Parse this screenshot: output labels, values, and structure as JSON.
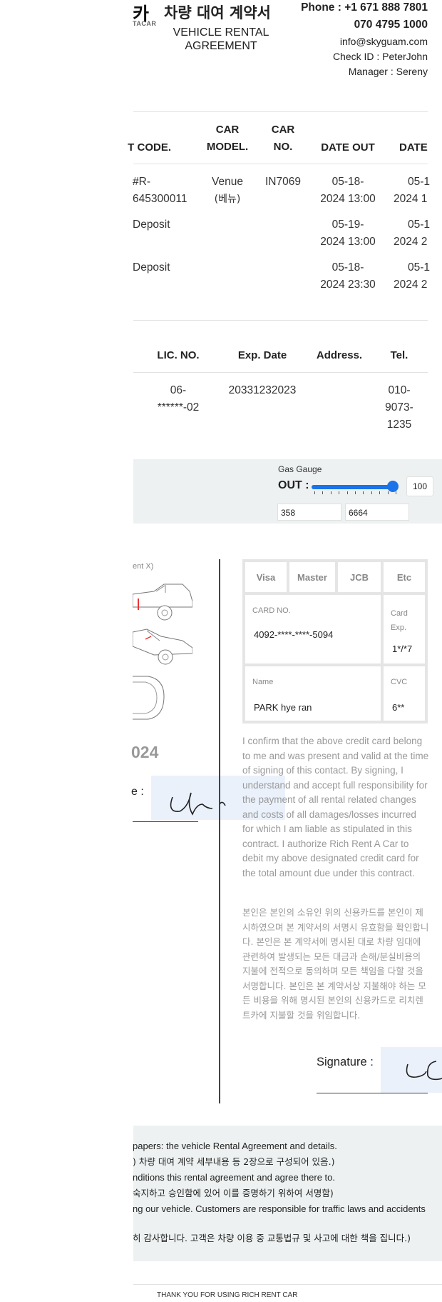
{
  "header": {
    "logo_text": "카",
    "logo_sub": "TACAR",
    "title_kr": "차량 대여 계약서",
    "title_en": "VEHICLE RENTAL AGREEMENT",
    "phone": "Phone : +1 671 888 7801",
    "phone2": "070 4795 1000",
    "email": "info@skyguam.com",
    "checkin": "Check ID : PeterJohn",
    "manager": "Manager : Sereny"
  },
  "rental_table": {
    "headers": [
      "T CODE.",
      "CAR",
      "MODEL.",
      "CAR",
      "NO.",
      "DATE OUT",
      "DATE"
    ],
    "rows": [
      {
        "code_1": "#R-",
        "code_2": "645300011",
        "model_1": "Venue",
        "model_2": "(베뉴)",
        "carno": "IN7069",
        "out_1": "05-18-",
        "out_2": "2024 13:00",
        "in_1": "05-1",
        "in_2": "2024 1"
      },
      {
        "code_1": "Deposit",
        "out_1": "05-19-",
        "out_2": "2024 13:00",
        "in_1": "05-1",
        "in_2": "2024 2"
      },
      {
        "code_1": "Deposit",
        "out_1": "05-18-",
        "out_2": "2024 23:30",
        "in_1": "05-1",
        "in_2": "2024 2"
      }
    ]
  },
  "license_table": {
    "headers": [
      "LIC. NO.",
      "Exp. Date",
      "Address.",
      "Tel."
    ],
    "row": {
      "lic_1": "06-",
      "lic_2": "******-02",
      "exp": "20331232023",
      "address": "",
      "tel_1": "010-",
      "tel_2": "9073-",
      "tel_3": "1235"
    }
  },
  "gauge": {
    "label": "Gas Gauge",
    "out_label": "OUT :",
    "value": 100,
    "value_text": "100",
    "mileage_1": "358",
    "mileage_2": "6664"
  },
  "left_section": {
    "caption": "ent X)",
    "date_fragment": "024",
    "sig_label": "e :"
  },
  "card": {
    "types": [
      "Visa",
      "Master",
      "JCB",
      "Etc"
    ],
    "card_no_label": "CARD NO.",
    "card_no": "4092-****-****-5094",
    "card_exp_label_1": "Card",
    "card_exp_label_2": "Exp.",
    "card_exp": "1*/*7",
    "name_label": "Name",
    "name": "PARK hye ran",
    "cvc_label": "CVC",
    "cvc": "6**"
  },
  "confirm_en": "I confirm that the above credit card belong to me and was present and valid at the time of signing of this contact. By signing, I understand and accept full responsibility for the payment of all rental related changes and costs of all damages/losses incurred for which I am liable as stipulated in this contract. I authorize Rich Rent A Car to debit my above designated credit card for the total amount due under this contract.",
  "confirm_kr": "본인은 본인의 소유인 위의 신용카드를 본인이 제시하였으며 본 계약서의 서명시 유효함을 확인합니다. 본인은 본 계약서에 명시된 대로 차량 임대에 관련하여 발생되는 모든 대금과 손해/분실비용의 지불에 전적으로 동의하며 모든 책임을 다할 것을 서명합니다. 본인은 본 계약서상 지불해야 하는 모든 비용을 위해 명시된 본인의 신용카드로 리치렌트카에 지불할 것을 위임합니다.",
  "signature_label": "Signature :",
  "footer": {
    "line1": "papers: the vehicle Rental Agreement and details.",
    "line1_kr": ") 차량 대여 계약 세부내용 등 2장으로 구성되어 있음.)",
    "line2": "nditions this rental agreement and agree there to.",
    "line2_kr": "숙지하고 승인함에 있어 이를 증명하기 위하여 서명함)",
    "line3": "ng our vehicle. Customers are responsible for traffic laws and accidents",
    "line3_kr": "히 감사합니다. 고객은 차량 이용 중 교통법규 및 사고에 대한 책을 집니다.)"
  },
  "thanks": "THANK YOU FOR USING RICH RENT CAR"
}
